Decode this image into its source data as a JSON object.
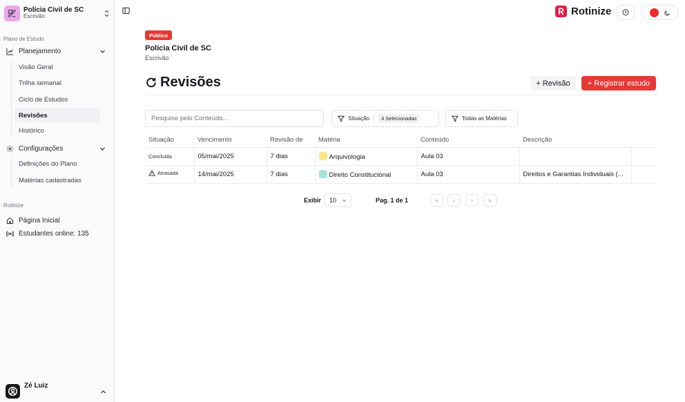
{
  "sidebar": {
    "org": {
      "name": "Polícia Civil de SC",
      "role": "Escrivão"
    },
    "section_plan": "Plano de Estudo",
    "planejamento": {
      "label": "Planejamento",
      "items": [
        "Visão Geral",
        "Trilha semanal",
        "Ciclo de Estudos",
        "Revisões",
        "Histórico"
      ]
    },
    "configuracoes": {
      "label": "Configurações",
      "items": [
        "Definições do Plano",
        "Matérias cadastradas"
      ]
    },
    "section_app": "Rotinize",
    "home": "Página Inicial",
    "online": "Estudantes online: 135",
    "user": "Zé Luiz"
  },
  "header": {
    "brand": "Rotinize"
  },
  "plan": {
    "badge": "Público",
    "title": "Polícia Civil de SC",
    "subtitle": "Escrivão"
  },
  "page": {
    "title": "Revisões",
    "btn_revisao": "+ Revisão",
    "btn_registrar": "+ Registrar estudo"
  },
  "filters": {
    "search_placeholder": "Pesquise pelo Conteúdo...",
    "situacao": "Situação",
    "situacao_selected": "4 Selecionadas",
    "materias": "Todas as Matérias"
  },
  "table": {
    "columns": [
      "Situação",
      "Vencimento",
      "Revisão de",
      "Matéria",
      "Conteúdo",
      "Descrição",
      ""
    ],
    "rows": [
      {
        "situacao": "Concluída",
        "vencimento": "05/mai/2025",
        "revisao": "7 dias",
        "materia": "Arquivologia",
        "materia_color": "#fde68a",
        "conteudo": "Aula 03",
        "descricao": ""
      },
      {
        "situacao": "Atrasada",
        "vencimento": "14/mai/2025",
        "revisao": "7 dias",
        "materia": "Direito Constitucional",
        "materia_color": "#a7e5d9",
        "conteudo": "Aula 03",
        "descricao": "Direitos e Garantias Individuais (..."
      }
    ]
  },
  "pagination": {
    "exibir_label": "Exibir",
    "page_size": "10",
    "page_label": "Pag. 1 de 1",
    "first": "«",
    "prev": "‹",
    "next": "›",
    "last": "»"
  },
  "colors": {
    "accent": "#e53935",
    "brand": "#e11d48",
    "org_logo": "#e9a7ea"
  }
}
